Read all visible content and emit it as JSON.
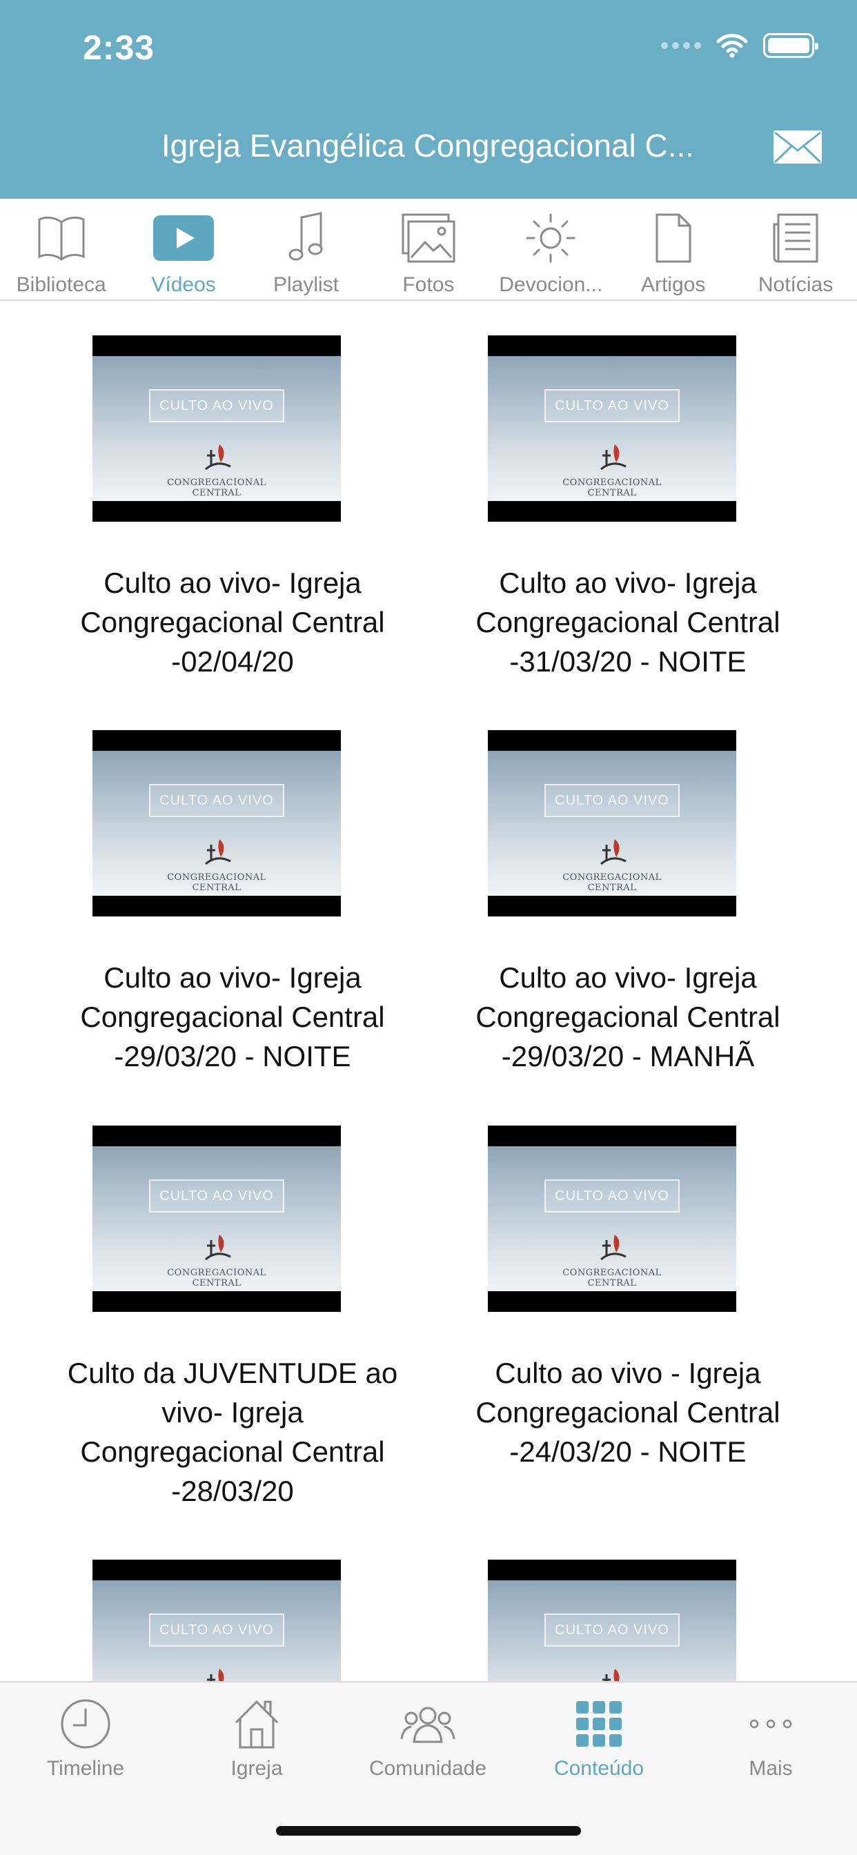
{
  "status": {
    "time": "2:33"
  },
  "header": {
    "title": "Igreja Evangélica Congregacional C..."
  },
  "top_tabs": [
    {
      "label": "Biblioteca",
      "icon": "book-icon",
      "active": false
    },
    {
      "label": "Vídeos",
      "icon": "play-icon",
      "active": true
    },
    {
      "label": "Playlist",
      "icon": "music-note-icon",
      "active": false
    },
    {
      "label": "Fotos",
      "icon": "photos-icon",
      "active": false
    },
    {
      "label": "Devocion...",
      "icon": "sun-icon",
      "active": false
    },
    {
      "label": "Artigos",
      "icon": "document-icon",
      "active": false
    },
    {
      "label": "Notícias",
      "icon": "news-icon",
      "active": false
    }
  ],
  "thumbnail": {
    "badge": "CULTO AO VIVO",
    "subtitle": "CONGREGACIONAL CENTRAL"
  },
  "videos": [
    {
      "title": "Culto ao vivo- Igreja Congregacional Central -02/04/20"
    },
    {
      "title": "Culto ao vivo- Igreja Congregacional Central -31/03/20 - NOITE"
    },
    {
      "title": "Culto ao vivo- Igreja Congregacional Central -29/03/20 - NOITE"
    },
    {
      "title": "Culto ao vivo- Igreja Congregacional Central -29/03/20 - MANHÃ"
    },
    {
      "title": "Culto da JUVENTUDE ao vivo- Igreja Congregacional Central -28/03/20"
    },
    {
      "title": "Culto ao vivo - Igreja Congregacional Central -24/03/20 - NOITE"
    },
    {
      "title": ""
    },
    {
      "title": ""
    }
  ],
  "bottom_tabs": [
    {
      "label": "Timeline",
      "icon": "clock-icon",
      "active": false
    },
    {
      "label": "Igreja",
      "icon": "church-icon",
      "active": false
    },
    {
      "label": "Comunidade",
      "icon": "people-icon",
      "active": false
    },
    {
      "label": "Conteúdo",
      "icon": "grid-icon",
      "active": true
    },
    {
      "label": "Mais",
      "icon": "more-icon",
      "active": false
    }
  ],
  "colors": {
    "header": "#6aaec6",
    "accent": "#5da7c1",
    "inactive": "#8a8a8a"
  }
}
